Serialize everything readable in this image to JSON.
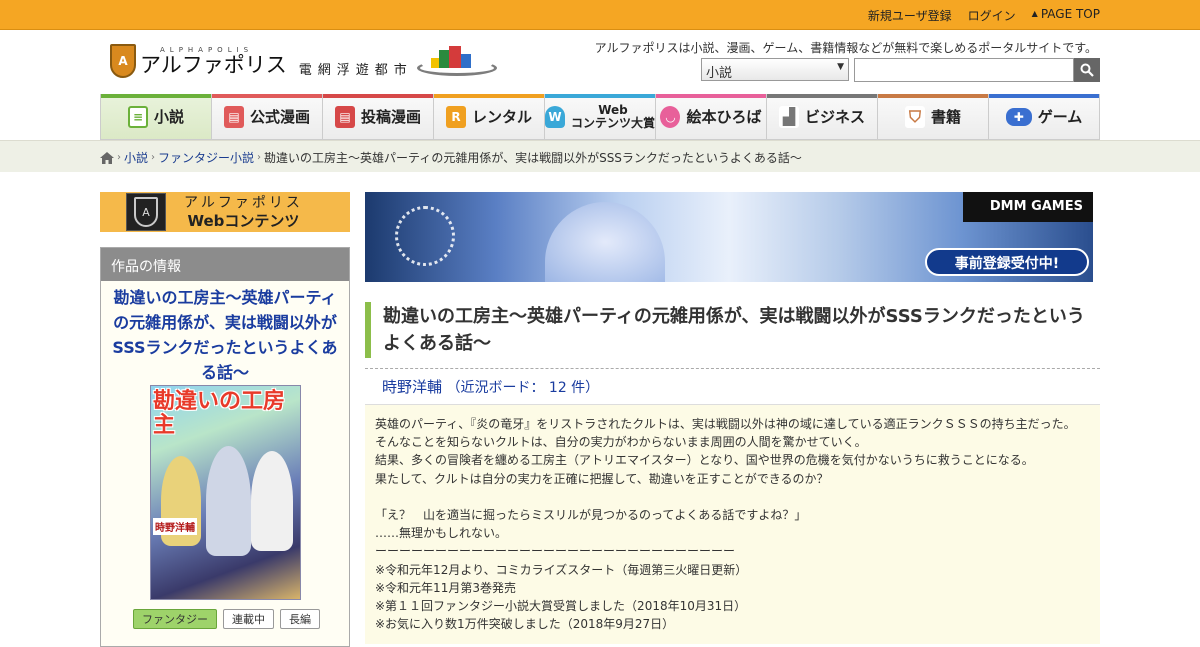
{
  "topbar": {
    "register": "新規ユーザ登録",
    "login": "ログイン",
    "pagetop": "PAGE TOP"
  },
  "header": {
    "logo_badge": "A",
    "logo_en": "ALPHAPOLIS",
    "logo_jp": "アルファポリス",
    "logo_sub": "電網浮遊都市",
    "tagline": "アルファポリスは小説、漫画、ゲーム、書籍情報などが無料で楽しめるポータルサイトです。",
    "search_select": "小説",
    "search_icon": "magnifier-icon"
  },
  "nav": {
    "tabs": [
      {
        "label": "小説",
        "icon": "novel-icon",
        "color": "#6bb13a"
      },
      {
        "label": "公式漫画",
        "icon": "manga-icon",
        "color": "#e05a5a"
      },
      {
        "label": "投稿漫画",
        "icon": "post-manga-icon",
        "color": "#d64848"
      },
      {
        "label": "レンタル",
        "icon": "rental-icon",
        "color": "#f0a020"
      },
      {
        "label1": "Web",
        "label2": "コンテンツ大賞",
        "icon": "trophy-icon",
        "color": "#3aa8d8"
      },
      {
        "label": "絵本ひろば",
        "icon": "picturebook-icon",
        "color": "#e8609a"
      },
      {
        "label": "ビジネス",
        "icon": "business-icon",
        "color": "#777777"
      },
      {
        "label": "書籍",
        "icon": "book-icon",
        "color": "#c87a45"
      },
      {
        "label": "ゲーム",
        "icon": "gamepad-icon",
        "color": "#3a6fd0"
      }
    ]
  },
  "breadcrumb": {
    "home_icon": "home-icon",
    "items": [
      "小説",
      "ファンタジー小説"
    ],
    "current": "勘違いの工房主～英雄パーティの元雑用係が、実は戦闘以外がSSSランクだったというよくある話～"
  },
  "sidebar": {
    "webcontents_t1": "アルファポリス",
    "webcontents_t2": "Webコンテンツ",
    "info_header": "作品の情報",
    "work_title": "勘違いの工房主～英雄パーティの元雑用係が、実は戦闘以外がSSSランクだったというよくある話～",
    "cover_title": "勘違いの工房主",
    "cover_author": "時野洋輔",
    "tags": [
      "ファンタジー",
      "連載中",
      "長編"
    ]
  },
  "banner": {
    "brand": "DMM GAMES",
    "cta": "事前登録受付中!"
  },
  "work": {
    "title": "勘違いの工房主～英雄パーティの元雑用係が、実は戦闘以外がSSSランクだったというよくある話～",
    "author": "時野洋輔",
    "board": "（近況ボード： 12 件）",
    "description": "英雄のパーティ、『炎の竜牙』をリストラされたクルトは、実は戦闘以外は神の域に達している適正ランクＳＳＳの持ち主だった。\nそんなことを知らないクルトは、自分の実力がわからないまま周囲の人間を驚かせていく。\n結果、多くの冒険者を纏める工房主（アトリエマイスター）となり、国や世界の危機を気付かないうちに救うことになる。\n果たして、クルトは自分の実力を正確に把握して、勘違いを正すことができるのか？\n\n「え？　山を適当に掘ったらミスリルが見つかるのってよくある話ですよね？」\n……無理かもしれない。\nーーーーーーーーーーーーーーーーーーーーーーーーーーーーーー\n※令和元年12月より、コミカライズスタート（毎週第三火曜日更新）\n※令和元年11月第3巻発売\n※第１１回ファンタジー小説大賞受賞しました（2018年10月31日）\n※お気に入り数1万件突破しました（2018年9月27日）"
  },
  "colors": {
    "topbar": "#f5a623",
    "accent_green": "#8cbe4a",
    "link_blue": "#1a3c9f"
  }
}
